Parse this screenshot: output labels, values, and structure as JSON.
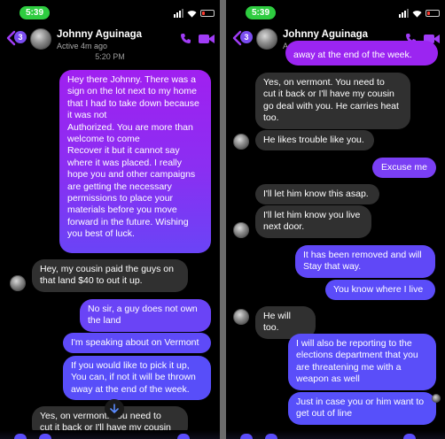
{
  "status": {
    "time": "5:39"
  },
  "conversation": {
    "contact_name": "Johnny Aguinaga",
    "active_status": "Active 4m ago",
    "unread_count": "3"
  },
  "left": {
    "timestamp": "5:20 PM",
    "messages": [
      {
        "from": "me",
        "text": "Hey there Johnny. There was a\nsign on the lot next to my home\nthat I had to take down because\nit was not\nAuthorized. You are more than\nwelcome to come\nRecover it but it cannot say\nwhere it was placed. I really\nhope you and other campaigns\nare getting the necessary\npermissions to place your\nmaterials before you move\nforward in the future. Wishing\nyou best of luck."
      },
      {
        "from": "them",
        "text": "Hey, my cousin paid the guys on\nthat land $40 to out it up."
      },
      {
        "from": "me",
        "text": "No sir, a guy does not own\nthe land"
      },
      {
        "from": "me",
        "text": "I'm speaking about on Vermont"
      },
      {
        "from": "me",
        "text": "If you would like to pick it up,\nYou can, if not it will be thrown\naway at the end of the week."
      },
      {
        "from": "them",
        "text": "Yes, on vermont. You need to\ncut it back or I'll have my cousin"
      }
    ]
  },
  "right": {
    "messages": [
      {
        "from": "me",
        "text": "away at the end of the week."
      },
      {
        "from": "them",
        "text": "Yes, on vermont. You need to\ncut it back or I'll have my cousin\ngo deal with you. He carries heat\ntoo."
      },
      {
        "from": "them",
        "text": "He likes trouble like you."
      },
      {
        "from": "me",
        "text": "Excuse me"
      },
      {
        "from": "them",
        "text": "I'll let him know this asap."
      },
      {
        "from": "them",
        "text": "I'll let him know you live\nnext door."
      },
      {
        "from": "me",
        "text": "It has been removed and will\nStay that way."
      },
      {
        "from": "me",
        "text": "You know where I live"
      },
      {
        "from": "them",
        "text": "He will too."
      },
      {
        "from": "me",
        "text": "I will also be reporting to the\nelections department that you\nare threatening me with a\nweapon as well"
      },
      {
        "from": "me",
        "text": "Just in case you or him want to\nget out of line"
      }
    ]
  },
  "colors": {
    "outgoing_start": "#a020f0",
    "outgoing_end": "#5b4dfa",
    "incoming": "#303030",
    "accent": "#a13cf7"
  },
  "icons": [
    "back-chevron-icon",
    "phone-icon",
    "video-camera-icon",
    "scroll-down-arrow-icon",
    "wifi-icon",
    "signal-icon",
    "battery-icon"
  ]
}
